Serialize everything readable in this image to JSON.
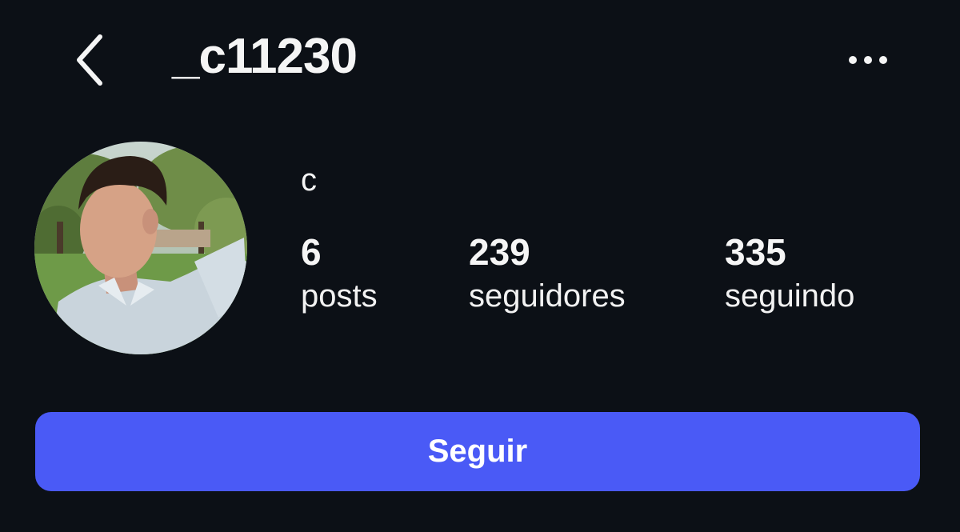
{
  "header": {
    "username": "_c11230",
    "back_icon": "chevron-left-icon",
    "more_icon": "more-horizontal-icon"
  },
  "profile": {
    "display_name": "c",
    "avatar": "profile-photo"
  },
  "stats": {
    "posts": {
      "value": "6",
      "label": "posts"
    },
    "followers": {
      "value": "239",
      "label": "seguidores"
    },
    "following": {
      "value": "335",
      "label": "seguindo"
    }
  },
  "actions": {
    "follow_label": "Seguir"
  },
  "colors": {
    "background": "#0c1016",
    "text": "#f5f5f5",
    "accent": "#4a5af6"
  }
}
